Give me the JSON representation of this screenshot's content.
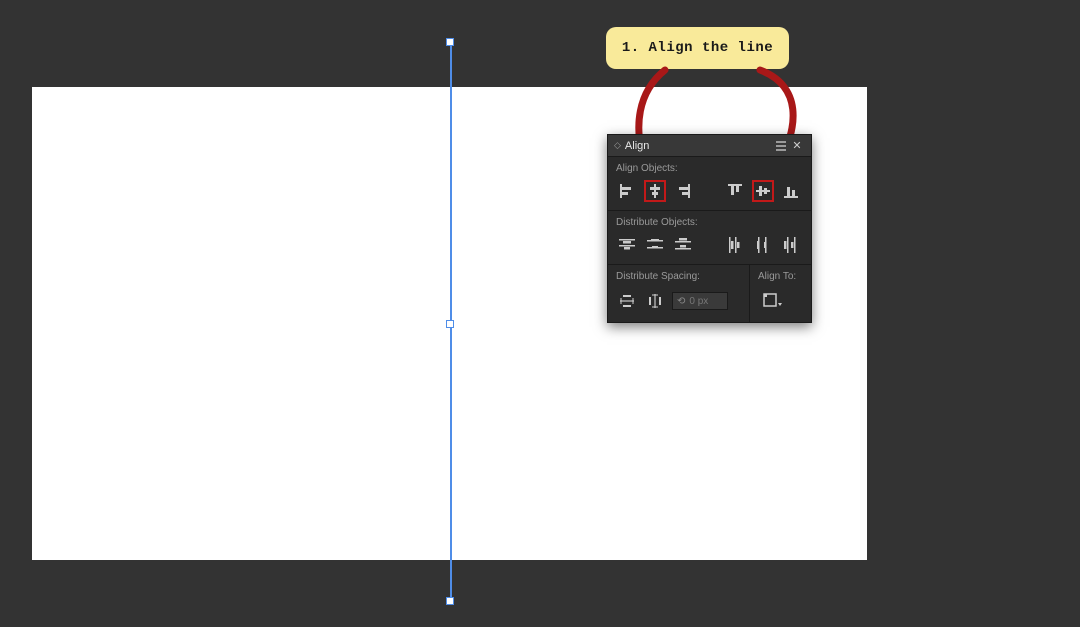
{
  "callout": {
    "text": "1. Align the line"
  },
  "panel": {
    "title": "Align",
    "sections": {
      "align_objects": "Align Objects:",
      "distribute_objects": "Distribute Objects:",
      "distribute_spacing": "Distribute Spacing:",
      "align_to": "Align To:"
    },
    "spacing_value": "0 px"
  }
}
